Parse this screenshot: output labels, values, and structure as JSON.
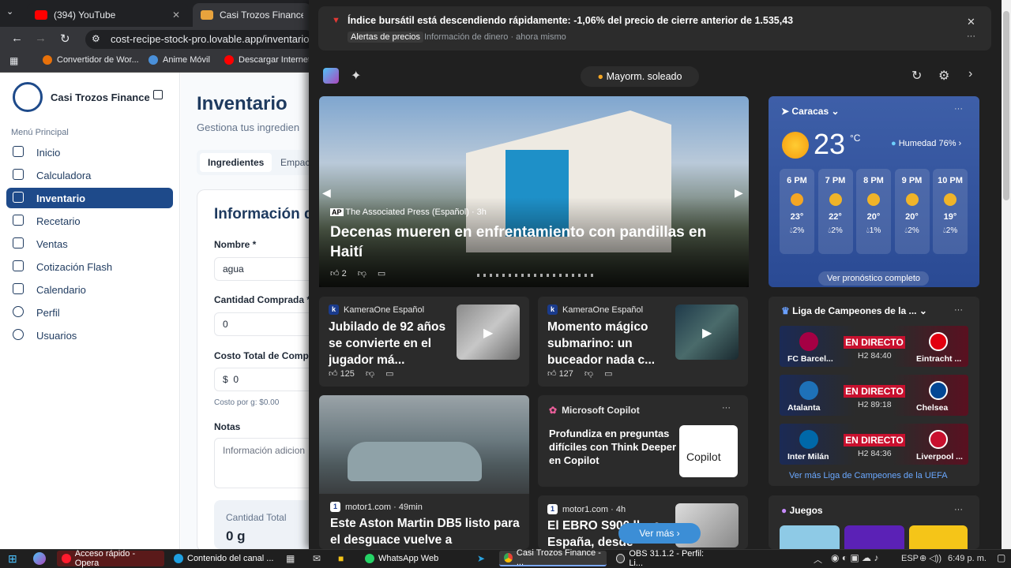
{
  "browser": {
    "tabs": [
      {
        "label": "(394) YouTube",
        "color": "#ff0000"
      },
      {
        "label": "Casi Trozos Finance - Ge",
        "color": "#e8a33d"
      }
    ],
    "url": "cost-recipe-stock-pro.lovable.app/inventario",
    "bookmarks": [
      "Convertidor de Wor...",
      "Anime Móvil",
      "Descargar Internet..."
    ]
  },
  "sidebar": {
    "brand": "Casi Trozos Finance",
    "menu_heading": "Menú Principal",
    "items": [
      "Inicio",
      "Calculadora",
      "Inventario",
      "Recetario",
      "Ventas",
      "Cotización Flash",
      "Calendario",
      "Perfil",
      "Usuarios"
    ]
  },
  "main": {
    "title": "Inventario",
    "subtitle": "Gestiona tus ingredien",
    "tabs": [
      "Ingredientes",
      "Empac"
    ],
    "card_title": "Información d",
    "fields": {
      "name_label": "Nombre *",
      "name_value": "agua",
      "qty_label": "Cantidad Comprada *",
      "qty_value": "0",
      "cost_label": "Costo Total de Compr",
      "cost_currency": "$",
      "cost_value": "0",
      "cost_per_g": "Costo por g: $0.00",
      "notes_label": "Notas",
      "notes_placeholder": "Información adicion",
      "total_label": "Cantidad Total",
      "total_value": "0 g"
    }
  },
  "widgets": {
    "alert": {
      "title": "Índice bursátil está descendiendo rápidamente: -1,06% del precio de cierre anterior de 1.535,43",
      "tag": "Alertas de precios",
      "source": "Información de dinero · ahora mismo"
    },
    "weather_pill": "Mayorm. soleado",
    "hero": {
      "source": "The Associated Press (Español) · 3h",
      "title": "Decenas mueren en enfrentamiento con pandillas en Haití",
      "likes": "2"
    },
    "news": [
      {
        "source": "KameraOne Español",
        "title": "Jubilado de 92 años se convierte en el jugador má...",
        "likes": "125"
      },
      {
        "source": "KameraOne Español",
        "title": "Momento mágico submarino: un buceador nada c...",
        "likes": "127"
      }
    ],
    "copilot": {
      "header": "Microsoft Copilot",
      "text": "Profundiza en preguntas difíciles con Think Deeper en Copilot",
      "logo": "Copilot"
    },
    "bottom_news": [
      {
        "source": "motor1.com · 49min",
        "title": "Este Aston Martin DB5 listo para el desguace vuelve a"
      },
      {
        "source": "motor1.com · 4h",
        "title": "El EBRO S900 ll... a España, desde"
      }
    ],
    "ver_mas": "Ver más",
    "weather": {
      "city": "Caracas",
      "temp": "23",
      "unit": "°C",
      "humidity": "Humedad 76%",
      "hours": [
        {
          "t": "6 PM",
          "temp": "23°",
          "rain": "2%",
          "icon": "sun"
        },
        {
          "t": "7 PM",
          "temp": "22°",
          "rain": "2%",
          "icon": "moon"
        },
        {
          "t": "8 PM",
          "temp": "20°",
          "rain": "1%",
          "icon": "moon"
        },
        {
          "t": "9 PM",
          "temp": "20°",
          "rain": "2%",
          "icon": "moon"
        },
        {
          "t": "10 PM",
          "temp": "19°",
          "rain": "2%",
          "icon": "cloud-moon"
        }
      ],
      "forecast_link": "Ver pronóstico completo"
    },
    "sports": {
      "title": "Liga de Campeones de la ...",
      "live": "EN DIRECTO",
      "matches": [
        {
          "home": "FC Barcel...",
          "away": "Eintracht ...",
          "time": "H2 84:40",
          "home_color": "#a50044",
          "away_color": "#e1000f"
        },
        {
          "home": "Atalanta",
          "away": "Chelsea",
          "time": "H2 89:18",
          "home_color": "#1e71b8",
          "away_color": "#034694"
        },
        {
          "home": "Inter Milán",
          "away": "Liverpool ...",
          "time": "H2 84:36",
          "home_color": "#0068a8",
          "away_color": "#c8102e"
        }
      ],
      "more": "Ver más Liga de Campeones de la UEFA"
    },
    "games_title": "Juegos"
  },
  "taskbar": {
    "items": [
      "Acceso rápido - Opera",
      "Contenido del canal ...",
      "WhatsApp Web",
      "Casi Trozos Finance - ...",
      "OBS 31.1.2 - Perfil: Li..."
    ],
    "lang": "ESP",
    "time": "6:49 p. m."
  }
}
